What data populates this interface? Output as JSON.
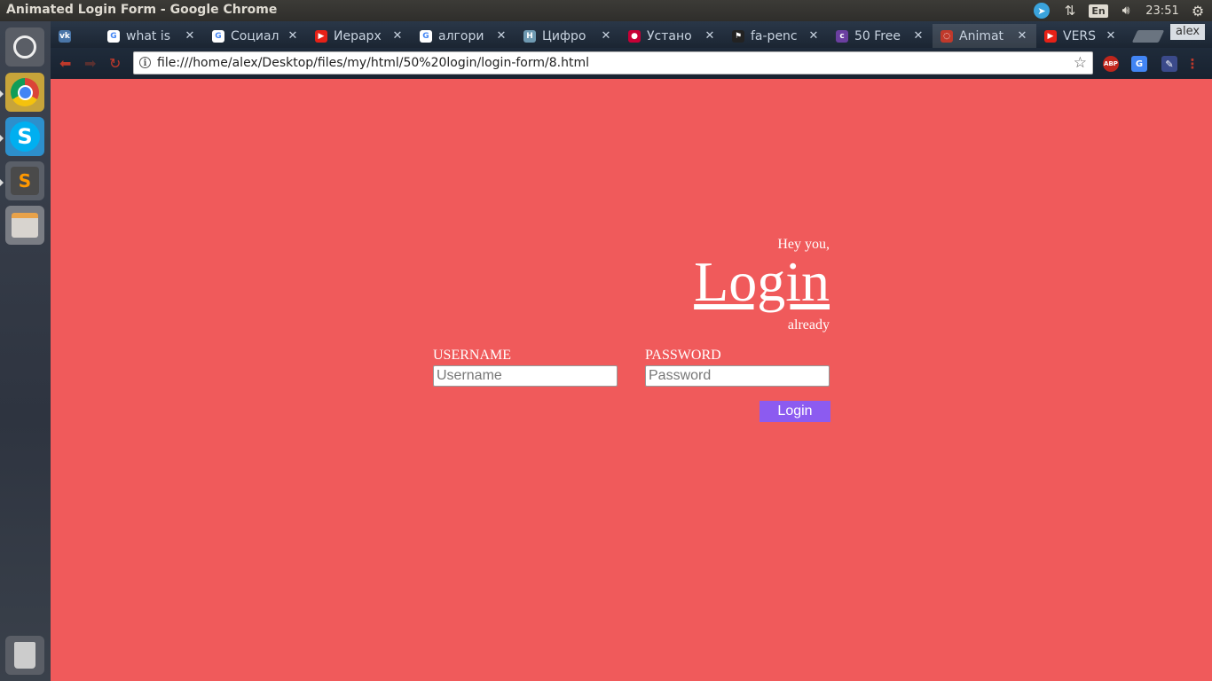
{
  "window": {
    "title": "Animated Login Form - Google Chrome"
  },
  "tray": {
    "lang": "En",
    "time": "23:51"
  },
  "tabs": [
    {
      "label": "",
      "icon": "vk-icon",
      "color": "#4a76a8",
      "glyph": "vk"
    },
    {
      "label": "what is",
      "icon": "google-icon",
      "color": "#ffffff",
      "glyph": "G"
    },
    {
      "label": "Социал",
      "icon": "google-icon",
      "color": "#ffffff",
      "glyph": "G"
    },
    {
      "label": "Иерарх",
      "icon": "youtube-icon",
      "color": "#e62117",
      "glyph": "▶"
    },
    {
      "label": "алгори",
      "icon": "google-icon",
      "color": "#ffffff",
      "glyph": "G"
    },
    {
      "label": "Цифро",
      "icon": "habr-icon",
      "color": "#6f9ab2",
      "glyph": "H"
    },
    {
      "label": "Устано",
      "icon": "debian-icon",
      "color": "#c70036",
      "glyph": "●"
    },
    {
      "label": "fa-penc",
      "icon": "flag-icon",
      "color": "#222222",
      "glyph": "⚑"
    },
    {
      "label": "50 Free",
      "icon": "colorlib-icon",
      "color": "#6b3fa0",
      "glyph": "c"
    },
    {
      "label": "Animat",
      "icon": "chrome-page-icon",
      "color": "#c0392b",
      "glyph": "◌"
    },
    {
      "label": "VERS",
      "icon": "youtube-icon",
      "color": "#e62117",
      "glyph": "▶"
    }
  ],
  "user_badge": "alex",
  "address_bar": {
    "url": "file:///home/alex/Desktop/files/my/html/50%20login/login-form/8.html"
  },
  "extensions": {
    "abp": "ABP",
    "translate": "G",
    "pencil": "✎",
    "menu": "⋮"
  },
  "form": {
    "greeting": "Hey you,",
    "title": "Login",
    "subtitle": "already",
    "username_label": "USERNAME",
    "username_placeholder": "Username",
    "password_label": "PASSWORD",
    "password_placeholder": "Password",
    "submit_label": "Login"
  },
  "colors": {
    "page_bg": "#f05a5b",
    "button_bg": "#8c5bf0"
  }
}
